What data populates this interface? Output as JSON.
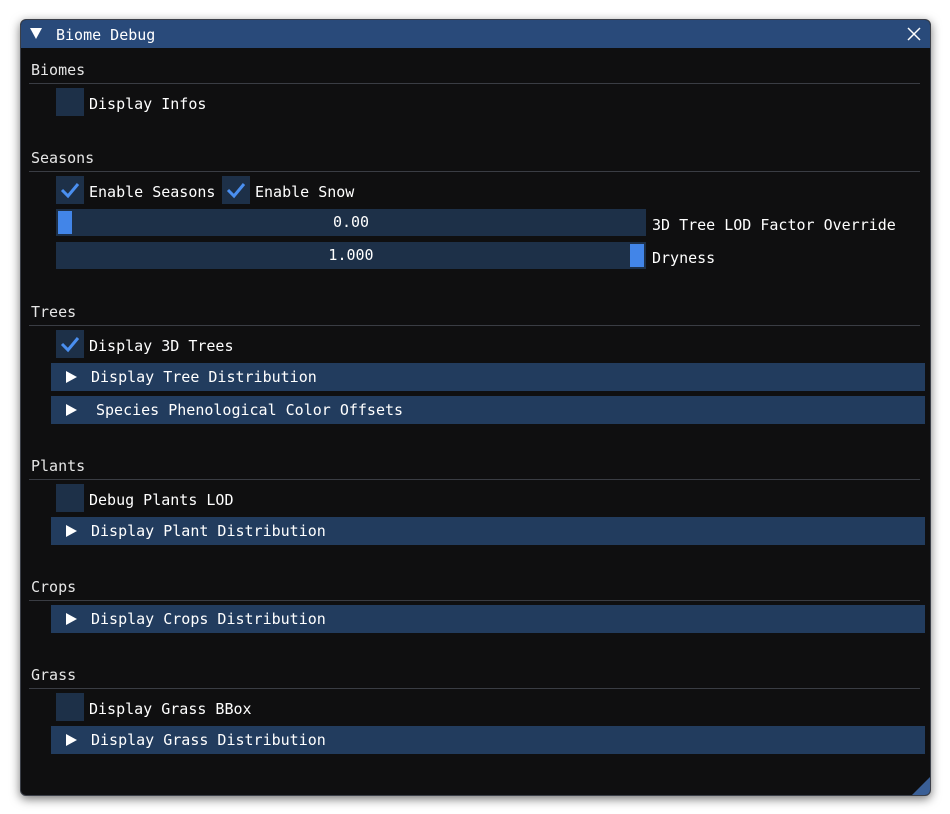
{
  "window": {
    "title": "Biome Debug"
  },
  "sections": {
    "biomes": {
      "title": "Biomes",
      "display_infos": {
        "label": "Display Infos",
        "checked": false
      }
    },
    "seasons": {
      "title": "Seasons",
      "enable_seasons": {
        "label": "Enable Seasons",
        "checked": true
      },
      "enable_snow": {
        "label": "Enable Snow",
        "checked": true
      },
      "tree_lod": {
        "value": "0.00",
        "label": "3D Tree LOD Factor Override",
        "fraction": 0.0
      },
      "dryness": {
        "value": "1.000",
        "label": "Dryness",
        "fraction": 1.0
      }
    },
    "trees": {
      "title": "Trees",
      "display_3d_trees": {
        "label": "Display 3D Trees",
        "checked": true
      },
      "tree_distribution": "Display Tree Distribution",
      "species_offsets": "Species Phenological Color Offsets"
    },
    "plants": {
      "title": "Plants",
      "debug_plants_lod": {
        "label": "Debug Plants LOD",
        "checked": false
      },
      "plant_distribution": "Display Plant Distribution"
    },
    "crops": {
      "title": "Crops",
      "crops_distribution": "Display Crops Distribution"
    },
    "grass": {
      "title": "Grass",
      "display_grass_bbox": {
        "label": "Display Grass BBox",
        "checked": false
      },
      "grass_distribution": "Display Grass Distribution"
    }
  },
  "colors": {
    "title_bar": "#294a7a",
    "window_bg": "#0f0f10",
    "frame_bg": "#1d3048",
    "header_bg": "#223c5e",
    "accent": "#4285e8"
  }
}
